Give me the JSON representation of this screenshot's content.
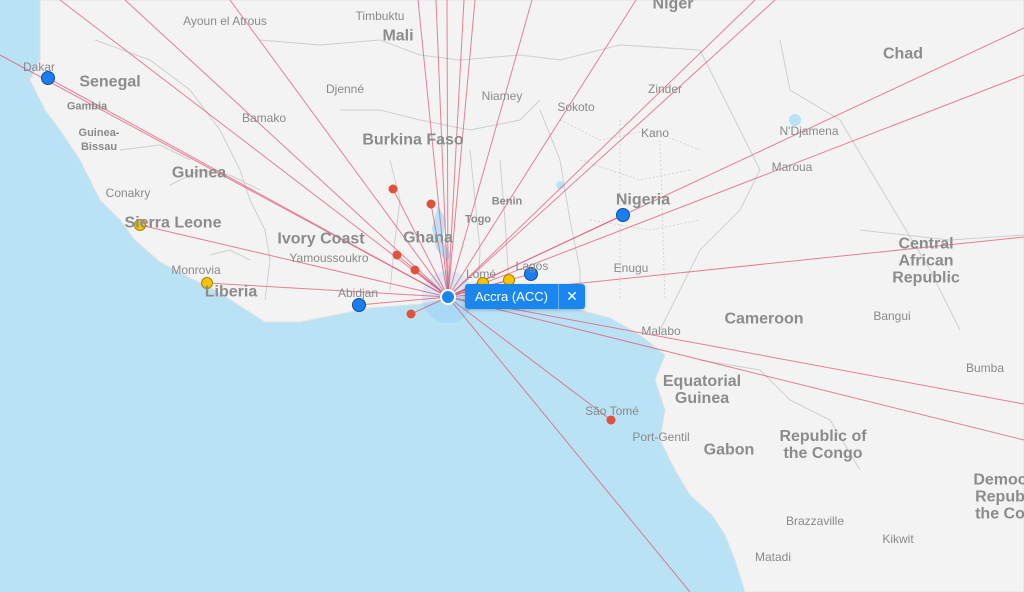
{
  "selected_airport": {
    "label": "Accra (ACC)",
    "close_icon": "close-icon",
    "close_glyph": "✕",
    "highlight_color": "#1a86f0"
  },
  "colors": {
    "ocean": "#b9e2f5",
    "land": "#f3f3f3",
    "route_line": "#e25a75",
    "marker_red": "#e0533a",
    "marker_yellow": "#f5c400",
    "marker_blue": "#1a7ef0"
  },
  "places": {
    "niger": "Niger",
    "mali": "Mali",
    "chad": "Chad",
    "senegal": "Senegal",
    "gambia": "Gambia",
    "guinea_bissau": "Guinea-\nBissau",
    "guinea": "Guinea",
    "burkina_faso": "Burkina Faso",
    "nigeria": "Nigeria",
    "sierra_leone": "Sierra Leone",
    "ivory_coast": "Ivory Coast",
    "ghana": "Ghana",
    "togo": "Togo",
    "benin": "Benin",
    "liberia": "Liberia",
    "car": "Central African\nRepublic",
    "cameroon": "Cameroon",
    "eq_guinea": "Equatorial\nGuinea",
    "gabon": "Gabon",
    "rep_congo": "Republic of\nthe Congo",
    "drc": "Democ\nRepub\nthe Co",
    "ayoun": "Ayoun el Atrous",
    "timbuktu": "Timbuktu",
    "dakar": "Dakar",
    "djenne": "Djenné",
    "bamako": "Bamako",
    "niamey": "Niamey",
    "sokoto": "Sokoto",
    "zinder": "Zinder",
    "kano": "Kano",
    "ndjamena": "N'Djamena",
    "conakry": "Conakry",
    "maroua": "Maroua",
    "yamoussoukro": "Yamoussoukro",
    "monrovia": "Monrovia",
    "abidjan": "Abidjan",
    "lome": "Lomé",
    "lagos": "Lagos",
    "enugu": "Enugu",
    "malabo": "Malabo",
    "bangui": "Bangui",
    "bumba": "Bumba",
    "sao_tome": "São Tomé",
    "port_gentil": "Port-Gentil",
    "brazzaville": "Brazzaville",
    "kikwit": "Kikwit",
    "matadi": "Matadi"
  },
  "airport_markers": [
    {
      "name": "Dakar",
      "color": "blue"
    },
    {
      "name": "Sierra Leone airport",
      "color": "yellow"
    },
    {
      "name": "Monrovia",
      "color": "yellow"
    },
    {
      "name": "Abidjan",
      "color": "blue"
    },
    {
      "name": "Lomé",
      "color": "yellow"
    },
    {
      "name": "Cotonou",
      "color": "yellow"
    },
    {
      "name": "Lagos",
      "color": "blue"
    },
    {
      "name": "Abuja",
      "color": "blue"
    },
    {
      "name": "Burkina airport",
      "color": "red"
    },
    {
      "name": "Tamale",
      "color": "red"
    },
    {
      "name": "Ghana north airport",
      "color": "red"
    },
    {
      "name": "Kumasi",
      "color": "red"
    },
    {
      "name": "Ghana central airport",
      "color": "red"
    },
    {
      "name": "Takoradi",
      "color": "red"
    },
    {
      "name": "São Tomé",
      "color": "red"
    }
  ]
}
